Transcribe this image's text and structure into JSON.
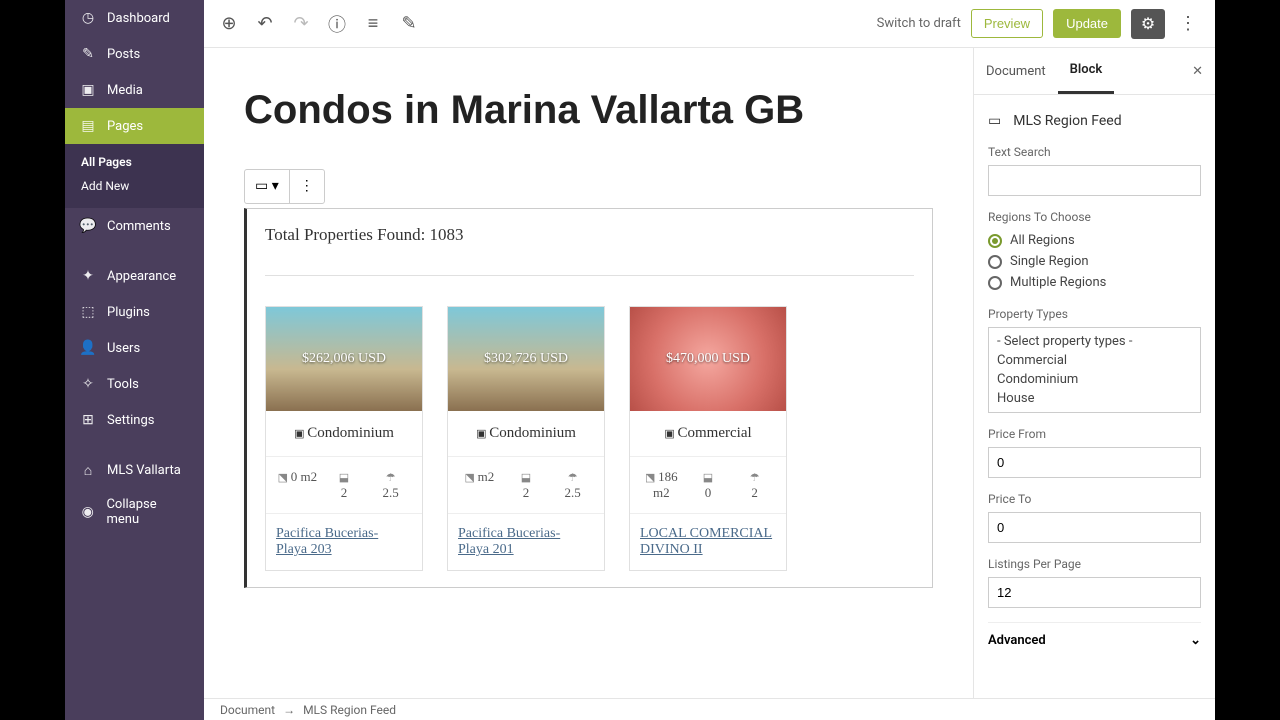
{
  "sidebar": {
    "items": [
      {
        "icon": "⌕",
        "label": "Dashboard"
      },
      {
        "icon": "✎",
        "label": "Posts"
      },
      {
        "icon": "▣",
        "label": "Media"
      },
      {
        "icon": "▤",
        "label": "Pages",
        "active": true
      },
      {
        "icon": "💬",
        "label": "Comments"
      },
      {
        "icon": "✦",
        "label": "Appearance"
      },
      {
        "icon": "⬚",
        "label": "Plugins"
      },
      {
        "icon": "👤",
        "label": "Users"
      },
      {
        "icon": "✧",
        "label": "Tools"
      },
      {
        "icon": "⊞",
        "label": "Settings"
      },
      {
        "icon": "⌂",
        "label": "MLS Vallarta"
      },
      {
        "icon": "◉",
        "label": "Collapse menu"
      }
    ],
    "sub": {
      "items": [
        "All Pages",
        "Add New"
      ],
      "active_index": 0
    }
  },
  "topbar": {
    "switch_draft": "Switch to draft",
    "preview": "Preview",
    "update": "Update"
  },
  "inspector": {
    "tabs": [
      "Document",
      "Block"
    ],
    "active_tab": 1,
    "block_name": "MLS Region Feed",
    "text_search_label": "Text Search",
    "text_search_value": "",
    "regions_label": "Regions To Choose",
    "regions_options": [
      "All Regions",
      "Single Region",
      "Multiple Regions"
    ],
    "regions_selected": 0,
    "ptypes_label": "Property Types",
    "ptypes_options": [
      "- Select property types -",
      "Commercial",
      "Condominium",
      "House"
    ],
    "price_from_label": "Price From",
    "price_from_value": "0",
    "price_to_label": "Price To",
    "price_to_value": "0",
    "listings_label": "Listings Per Page",
    "listings_value": "12",
    "advanced_label": "Advanced"
  },
  "editor": {
    "page_title": "Condos in Marina Vallarta GB",
    "total_prefix": "Total Properties Found: ",
    "total_count": "1083",
    "cards": [
      {
        "price": "$262,006 USD",
        "type": "Condominium",
        "area": "0 m2",
        "beds": "2",
        "baths": "2.5",
        "title": "Pacifica Bucerias- Playa 203"
      },
      {
        "price": "$302,726 USD",
        "type": "Condominium",
        "area": "m2",
        "beds": "2",
        "baths": "2.5",
        "title": "Pacifica Bucerias- Playa 201"
      },
      {
        "price": "$470,000 USD",
        "type": "Commercial",
        "area": "186 m2",
        "beds": "0",
        "baths": "2",
        "title": "LOCAL COMERCIAL DIVINO II",
        "pink": true
      }
    ]
  },
  "breadcrumb": {
    "parts": [
      "Document",
      "MLS Region Feed"
    ]
  },
  "colors": {
    "accent": "#9db83c",
    "sidebar": "#4a3e5c"
  }
}
